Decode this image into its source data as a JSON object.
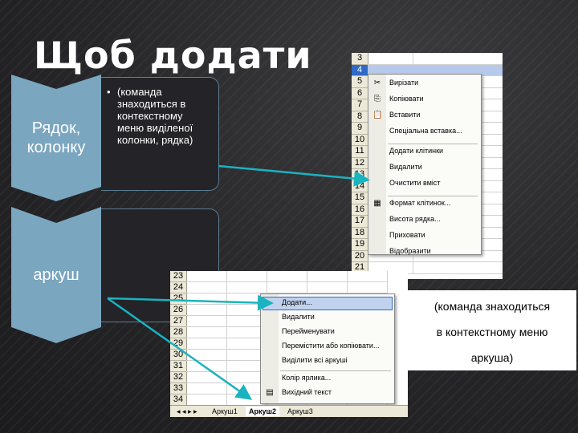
{
  "title": "Щоб додати",
  "steps": [
    {
      "label": "Рядок, колонку",
      "bullet": "(команда знаходиться в контекстному меню виділеної колонки, рядка)"
    },
    {
      "label": "аркуш",
      "bullet": ""
    }
  ],
  "row_menu": {
    "row_numbers": [
      "3",
      "4",
      "5",
      "6",
      "7",
      "8",
      "9",
      "10",
      "11",
      "12",
      "13",
      "14",
      "15",
      "16",
      "17",
      "18",
      "19",
      "20",
      "21"
    ],
    "items": [
      "Вирізати",
      "Копіювати",
      "Вставити",
      "Спеціальна вставка...",
      "Додати клітинки",
      "Видалити",
      "Очистити вміст",
      "Формат клітинок...",
      "Висота рядка...",
      "Приховати",
      "Відобразити"
    ]
  },
  "sheet_menu": {
    "row_numbers": [
      "23",
      "24",
      "25",
      "26",
      "27",
      "28",
      "29",
      "30",
      "31",
      "32",
      "33",
      "34"
    ],
    "items": [
      "Додати...",
      "Видалити",
      "Перейменувати",
      "Перемістити або копіювати...",
      "Виділити всі аркуші",
      "Колір ярлика...",
      "Вихідний текст"
    ],
    "tabs": [
      "Аркуш1",
      "Аркуш2",
      "Аркуш3"
    ]
  },
  "note_lines": [
    "(команда знаходиться",
    "в контекстному меню",
    "аркуша)"
  ],
  "colors": {
    "chevron": "#7aa6c0",
    "arrow": "#1ab3c0",
    "background": "#262629"
  }
}
